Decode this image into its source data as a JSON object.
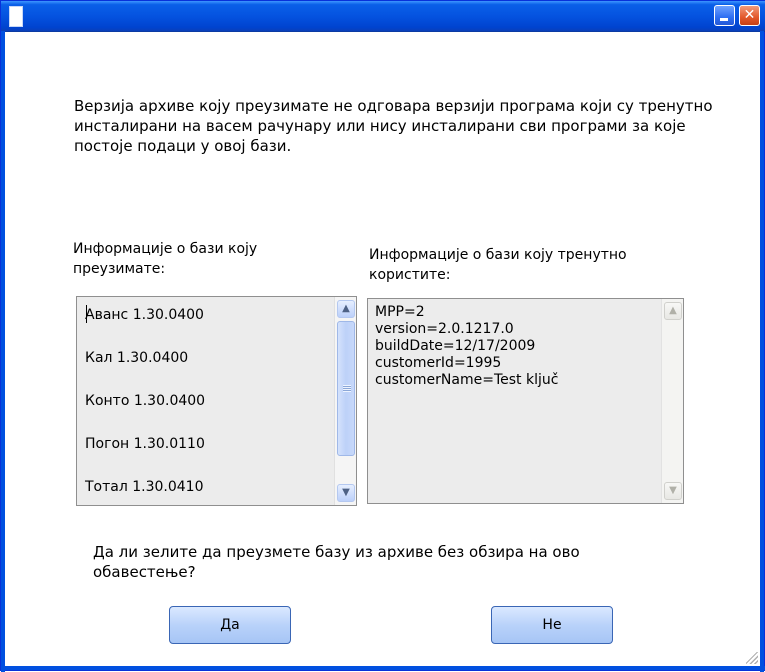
{
  "window": {
    "title": "",
    "minimize_label": "_",
    "close_label": "✕"
  },
  "message": "Верзија архиве коју преузимате не одговара верзији програма који су тренутно инсталирани на васем рачунару или нису инсталирани сви програми за које постоје подаци у овој бази.",
  "left_panel": {
    "label": "Информације о бази  коју преузимате:",
    "items": [
      "Аванс 1.30.0400",
      "Кал 1.30.0400",
      "Конто 1.30.0400",
      "Погон 1.30.0110",
      "Тотал 1.30.0410"
    ]
  },
  "right_panel": {
    "label": "Информације о бази коју тренутно користите:",
    "items": [
      "MPP=2",
      "version=2.0.1217.0",
      "buildDate=12/17/2009",
      "customerId=1995",
      "customerName=Test ključ"
    ]
  },
  "question": "Да ли зелите да преузмете базу из архиве без обзира на ово обавестење?",
  "buttons": {
    "yes": "Да",
    "no": "Не"
  }
}
